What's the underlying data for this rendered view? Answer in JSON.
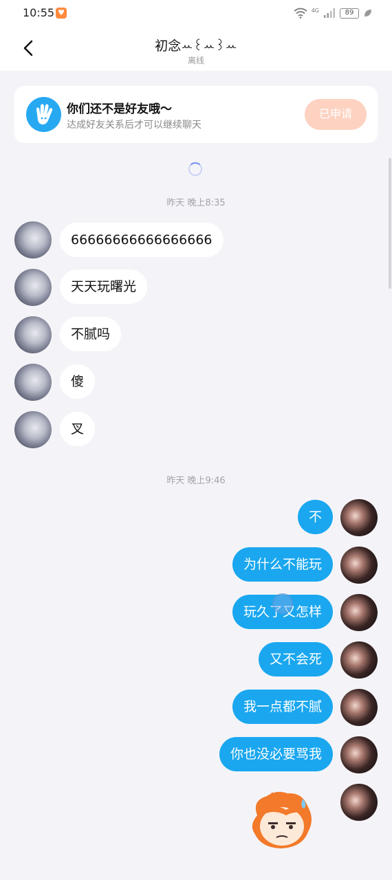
{
  "status_bar": {
    "time": "10:55",
    "network": "4G",
    "battery": "89"
  },
  "header": {
    "contact_name": "初念ꕀ꒰ꕀ꒱ꕀ",
    "contact_status": "离线"
  },
  "friend_banner": {
    "title": "你们还不是好友哦～",
    "subtitle": "达成好友关系后才可以继续聊天",
    "button_label": "已申请"
  },
  "timestamps": [
    "昨天 晚上8:35",
    "昨天 晚上9:46"
  ],
  "received_messages": [
    "66666666666666666",
    "天天玩曙光",
    "不腻吗",
    "傻",
    "叉"
  ],
  "sent_messages": [
    "不",
    "为什么不能玩",
    "玩久了又怎样",
    "又不会死",
    "我一点都不腻",
    "你也没必要骂我"
  ],
  "colors": {
    "accent": "#1aa7ef",
    "button_disabled": "#fdd2c1",
    "background": "#f4f4f8"
  }
}
